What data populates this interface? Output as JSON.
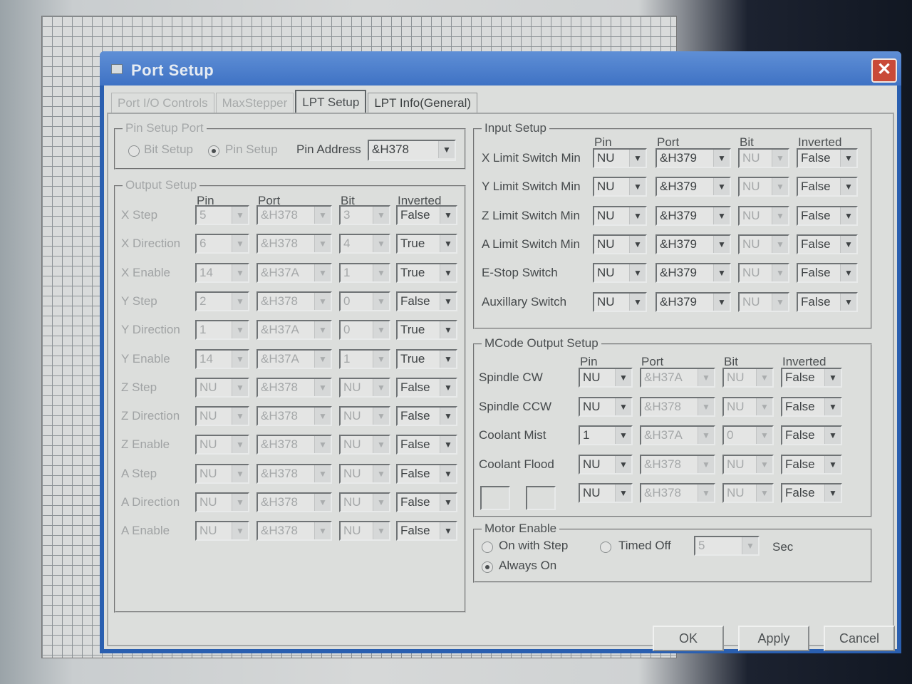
{
  "window": {
    "title": "Port Setup",
    "close_label": "✕"
  },
  "tabs": [
    {
      "label": "Port I/O Controls"
    },
    {
      "label": "MaxStepper"
    },
    {
      "label": "LPT Setup"
    },
    {
      "label": "LPT Info(General)"
    }
  ],
  "pin_setup_port": {
    "title": "Pin Setup Port",
    "bit_setup_label": "Bit Setup",
    "pin_setup_label": "Pin Setup",
    "selected": "Pin Setup",
    "pin_address_label": "Pin Address",
    "pin_address_value": "&H378"
  },
  "output_setup": {
    "title": "Output Setup",
    "headers": {
      "pin": "Pin",
      "port": "Port",
      "bit": "Bit",
      "inverted": "Inverted"
    },
    "rows": [
      {
        "label": "X Step",
        "pin": "5",
        "port": "&H378",
        "bit": "3",
        "inverted": "False"
      },
      {
        "label": "X Direction",
        "pin": "6",
        "port": "&H378",
        "bit": "4",
        "inverted": "True"
      },
      {
        "label": "X Enable",
        "pin": "14",
        "port": "&H37A",
        "bit": "1",
        "inverted": "True"
      },
      {
        "label": "Y Step",
        "pin": "2",
        "port": "&H378",
        "bit": "0",
        "inverted": "False"
      },
      {
        "label": "Y Direction",
        "pin": "1",
        "port": "&H37A",
        "bit": "0",
        "inverted": "True"
      },
      {
        "label": "Y Enable",
        "pin": "14",
        "port": "&H37A",
        "bit": "1",
        "inverted": "True"
      },
      {
        "label": "Z Step",
        "pin": "NU",
        "port": "&H378",
        "bit": "NU",
        "inverted": "False"
      },
      {
        "label": "Z Direction",
        "pin": "NU",
        "port": "&H378",
        "bit": "NU",
        "inverted": "False"
      },
      {
        "label": "Z Enable",
        "pin": "NU",
        "port": "&H378",
        "bit": "NU",
        "inverted": "False"
      },
      {
        "label": "A Step",
        "pin": "NU",
        "port": "&H378",
        "bit": "NU",
        "inverted": "False"
      },
      {
        "label": "A Direction",
        "pin": "NU",
        "port": "&H378",
        "bit": "NU",
        "inverted": "False"
      },
      {
        "label": "A Enable",
        "pin": "NU",
        "port": "&H378",
        "bit": "NU",
        "inverted": "False"
      }
    ]
  },
  "input_setup": {
    "title": "Input Setup",
    "headers": {
      "pin": "Pin",
      "port": "Port",
      "bit": "Bit",
      "inverted": "Inverted"
    },
    "rows": [
      {
        "label": "X Limit Switch Min",
        "pin": "NU",
        "port": "&H379",
        "bit": "NU",
        "inverted": "False"
      },
      {
        "label": "Y Limit Switch Min",
        "pin": "NU",
        "port": "&H379",
        "bit": "NU",
        "inverted": "False"
      },
      {
        "label": "Z Limit Switch Min",
        "pin": "NU",
        "port": "&H379",
        "bit": "NU",
        "inverted": "False"
      },
      {
        "label": "A Limit Switch Min",
        "pin": "NU",
        "port": "&H379",
        "bit": "NU",
        "inverted": "False"
      },
      {
        "label": "E-Stop Switch",
        "pin": "NU",
        "port": "&H379",
        "bit": "NU",
        "inverted": "False"
      },
      {
        "label": "Auxillary Switch",
        "pin": "NU",
        "port": "&H379",
        "bit": "NU",
        "inverted": "False"
      }
    ]
  },
  "mcode_output_setup": {
    "title": "MCode Output Setup",
    "headers": {
      "pin": "Pin",
      "port": "Port",
      "bit": "Bit",
      "inverted": "Inverted"
    },
    "rows": [
      {
        "label": "Spindle CW",
        "pin": "NU",
        "port": "&H37A",
        "bit": "NU",
        "inverted": "False"
      },
      {
        "label": "Spindle CCW",
        "pin": "NU",
        "port": "&H378",
        "bit": "NU",
        "inverted": "False"
      },
      {
        "label": "Coolant Mist",
        "pin": "1",
        "port": "&H37A",
        "bit": "0",
        "inverted": "False"
      },
      {
        "label": "Coolant Flood",
        "pin": "NU",
        "port": "&H378",
        "bit": "NU",
        "inverted": "False"
      },
      {
        "label": "",
        "pin": "NU",
        "port": "&H378",
        "bit": "NU",
        "inverted": "False"
      }
    ]
  },
  "motor_enable": {
    "title": "Motor Enable",
    "on_with_step_label": "On with Step",
    "timed_off_label": "Timed Off",
    "always_on_label": "Always On",
    "selected": "Always On",
    "timed_value": "5",
    "sec_label": "Sec"
  },
  "buttons": {
    "ok": "OK",
    "apply": "Apply",
    "cancel": "Cancel"
  }
}
